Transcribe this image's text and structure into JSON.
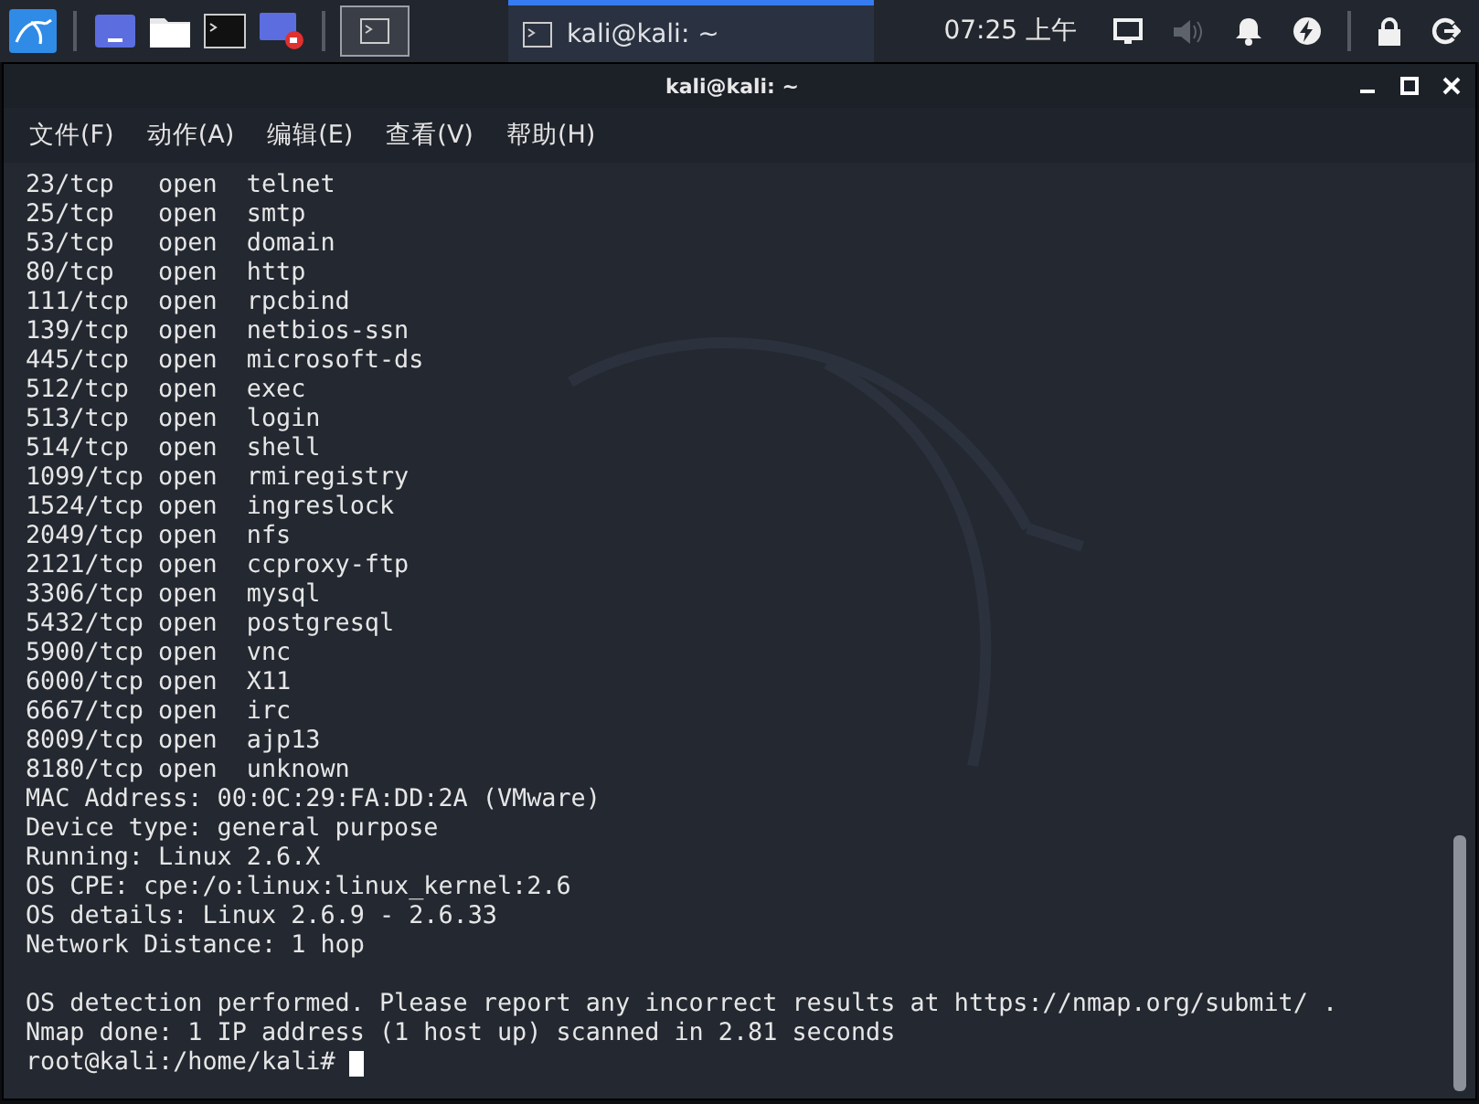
{
  "taskbar": {
    "launchers": [
      {
        "kind": "kali"
      },
      {
        "kind": "desktop"
      },
      {
        "kind": "folder"
      },
      {
        "kind": "terminal"
      },
      {
        "kind": "recorder"
      }
    ],
    "workspace_button": {
      "selected": true
    },
    "task": {
      "title": "kali@kali: ~",
      "selected": true
    },
    "clock": "07:25 上午",
    "tray": [
      {
        "kind": "display",
        "disabled": false
      },
      {
        "kind": "volume",
        "disabled": true
      },
      {
        "kind": "bell",
        "disabled": false
      },
      {
        "kind": "power",
        "disabled": false
      },
      {
        "kind": "lock",
        "disabled": false
      },
      {
        "kind": "logout",
        "disabled": false
      }
    ]
  },
  "window": {
    "title": "kali@kali: ~"
  },
  "menu": [
    "文件(F)",
    "动作(A)",
    "编辑(E)",
    "查看(V)",
    "帮助(H)"
  ],
  "terminal": {
    "lines": [
      "23/tcp   open  telnet",
      "25/tcp   open  smtp",
      "53/tcp   open  domain",
      "80/tcp   open  http",
      "111/tcp  open  rpcbind",
      "139/tcp  open  netbios-ssn",
      "445/tcp  open  microsoft-ds",
      "512/tcp  open  exec",
      "513/tcp  open  login",
      "514/tcp  open  shell",
      "1099/tcp open  rmiregistry",
      "1524/tcp open  ingreslock",
      "2049/tcp open  nfs",
      "2121/tcp open  ccproxy-ftp",
      "3306/tcp open  mysql",
      "5432/tcp open  postgresql",
      "5900/tcp open  vnc",
      "6000/tcp open  X11",
      "6667/tcp open  irc",
      "8009/tcp open  ajp13",
      "8180/tcp open  unknown",
      "MAC Address: 00:0C:29:FA:DD:2A (VMware)",
      "Device type: general purpose",
      "Running: Linux 2.6.X",
      "OS CPE: cpe:/o:linux:linux_kernel:2.6",
      "OS details: Linux 2.6.9 - 2.6.33",
      "Network Distance: 1 hop"
    ],
    "summary": [
      "OS detection performed. Please report any incorrect results at https://nmap.org/submit/ .",
      "Nmap done: 1 IP address (1 host up) scanned in 2.81 seconds"
    ],
    "prompt": "root@kali:/home/kali#"
  }
}
